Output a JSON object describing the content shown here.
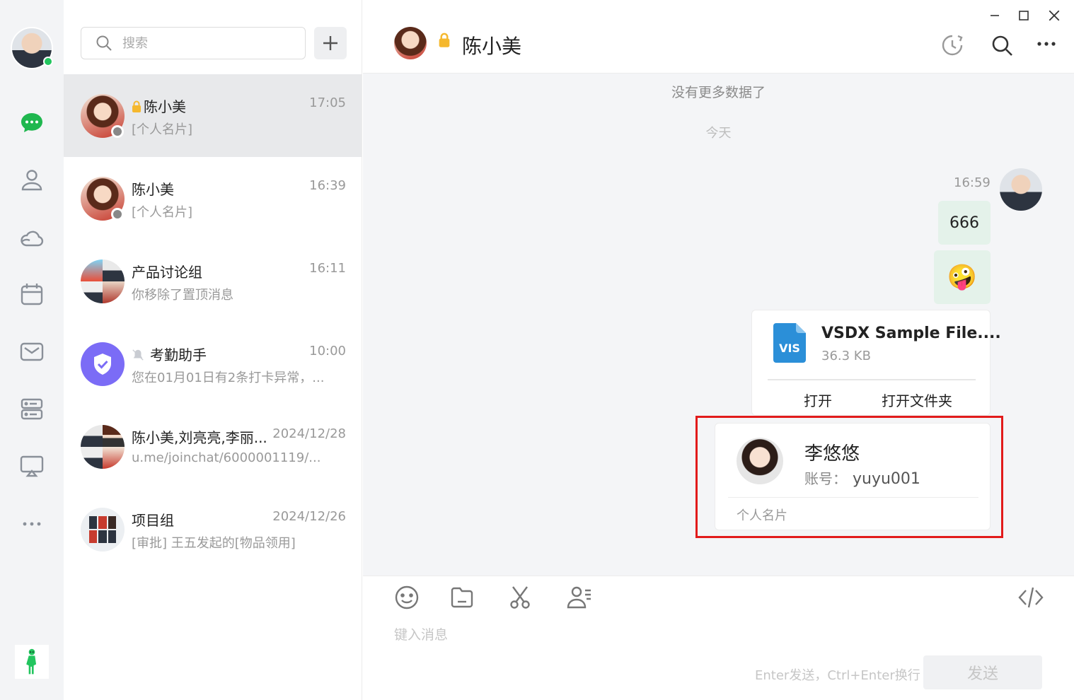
{
  "search": {
    "placeholder": "搜索"
  },
  "conversations": [
    {
      "name": "陈小美",
      "time": "17:05",
      "preview": "[个人名片]"
    },
    {
      "name": "陈小美",
      "time": "16:39",
      "preview": "[个人名片]"
    },
    {
      "name": "产品讨论组",
      "time": "16:11",
      "preview": "你移除了置顶消息"
    },
    {
      "name": "考勤助手",
      "time": "10:00",
      "preview": "您在01月01日有2条打卡异常，..."
    },
    {
      "name": "陈小美,刘亮亮,李丽...",
      "time": "2024/12/28",
      "preview": "u.me/joinchat/6000001119/..."
    },
    {
      "name": "项目组",
      "time": "2024/12/26",
      "preview": "[审批] 王五发起的[物品领用]"
    }
  ],
  "chat": {
    "title": "陈小美",
    "no_more": "没有更多数据了",
    "today": "今天",
    "msg_time": "16:59",
    "text_message": "666",
    "emoji": "🤪",
    "file": {
      "name": "VSDX Sample File....",
      "size": "36.3 KB",
      "ext": "VIS",
      "open": "打开",
      "open_folder": "打开文件夹"
    },
    "contact_card": {
      "name": "李悠悠",
      "account_label": "账号：",
      "account": "yuyu001",
      "type": "个人名片"
    }
  },
  "composer": {
    "placeholder": "键入消息",
    "hint": "Enter发送，Ctrl+Enter换行",
    "send": "发送"
  },
  "colors": {
    "accent": "#1fb74f",
    "bubble": "#e4f2ea",
    "highlight": "#e21b1b",
    "assistant": "#7b6cf6"
  }
}
